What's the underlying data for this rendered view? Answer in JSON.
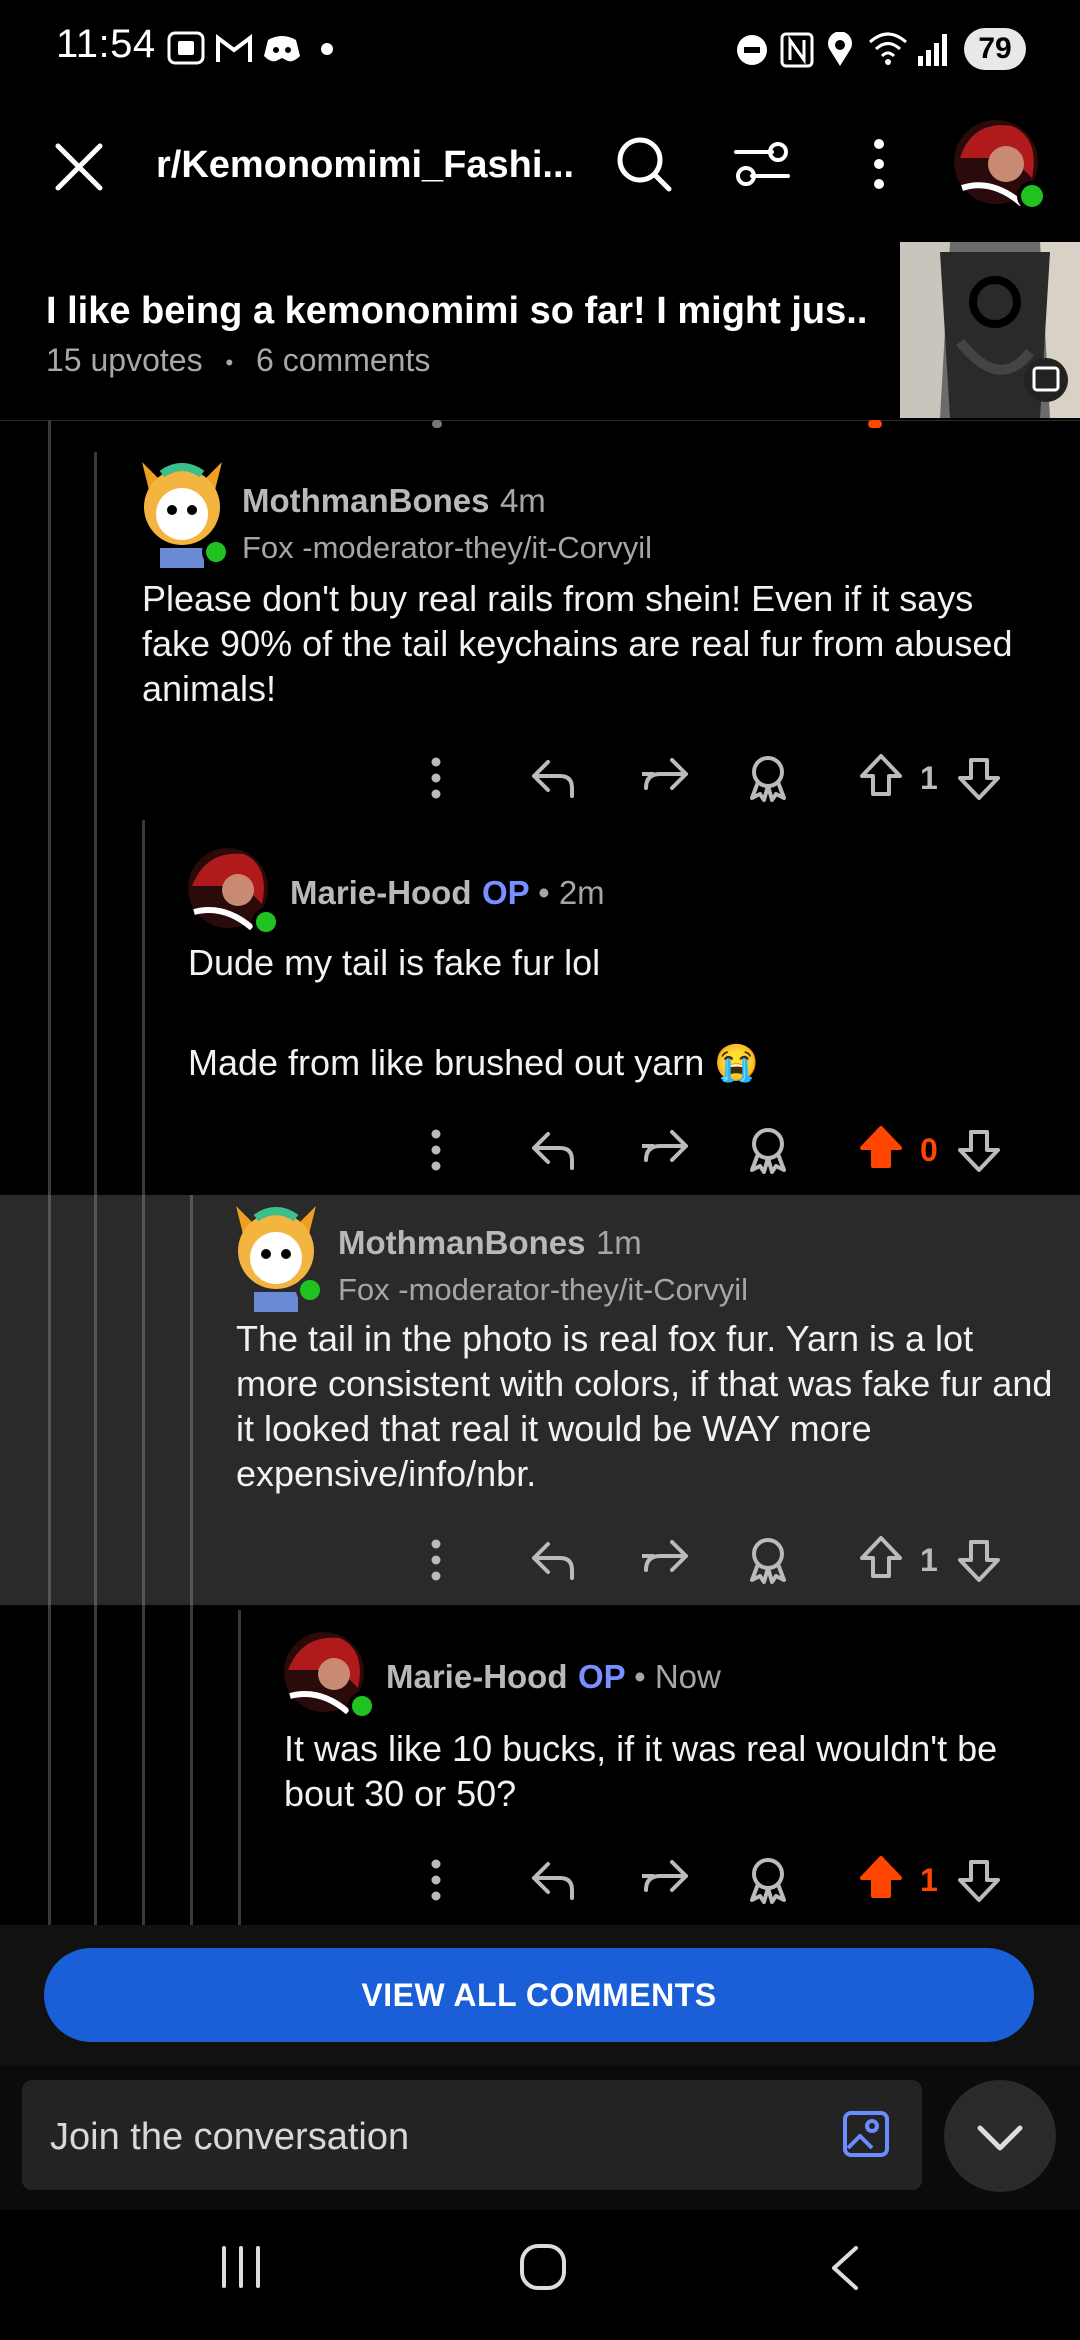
{
  "status_bar": {
    "time": "11:54",
    "battery": "79",
    "icons": [
      "screenshot-icon",
      "gmail-icon",
      "discord-icon",
      "dot-icon",
      "do-not-disturb-icon",
      "nfc-icon",
      "location-icon",
      "wifi-icon",
      "signal-icon"
    ]
  },
  "header": {
    "subreddit": "r/Kemonomimi_Fashi...",
    "icons": [
      "close-icon",
      "search-icon",
      "filter-icon",
      "more-vertical-icon",
      "avatar"
    ]
  },
  "post": {
    "title": "I like being a kemonomimi so far! I might jus...",
    "upvotes": "15 upvotes",
    "separator": "•",
    "comments": "6 comments"
  },
  "comments": [
    {
      "username": "MothmanBones",
      "time": "4m",
      "flair": "Fox -moderator-they/it-Corvyil",
      "body": "Please don't buy real rails from shein! Even if it says fake 90% of the tail keychains are real fur from abused animals!",
      "votes": "1"
    },
    {
      "username": "Marie-Hood",
      "op": "OP",
      "time": "• 2m",
      "body_line1": "Dude my tail is fake fur lol",
      "body_line2": "Made from like brushed out yarn 😭",
      "votes": "0"
    },
    {
      "username": "MothmanBones",
      "time": "1m",
      "flair": "Fox -moderator-they/it-Corvyil",
      "body": "The tail in the photo is real fox fur. Yarn is a lot more consistent with colors, if that was fake fur and it looked that real it would be WAY more expensive/info/nbr.",
      "votes": "1"
    },
    {
      "username": "Marie-Hood",
      "op": "OP",
      "time": "• Now",
      "body": "It was like 10 bucks, if it was real wouldn't be bout 30 or 50?",
      "votes": "1"
    }
  ],
  "bottom": {
    "view_all": "VIEW ALL COMMENTS",
    "join_placeholder": "Join the conversation"
  },
  "colors": {
    "background": "#000000",
    "highlight": "#2a2a2a",
    "upvote_active": "#ff4500",
    "op": "#7a8fff",
    "button": "#1a5ed8"
  }
}
